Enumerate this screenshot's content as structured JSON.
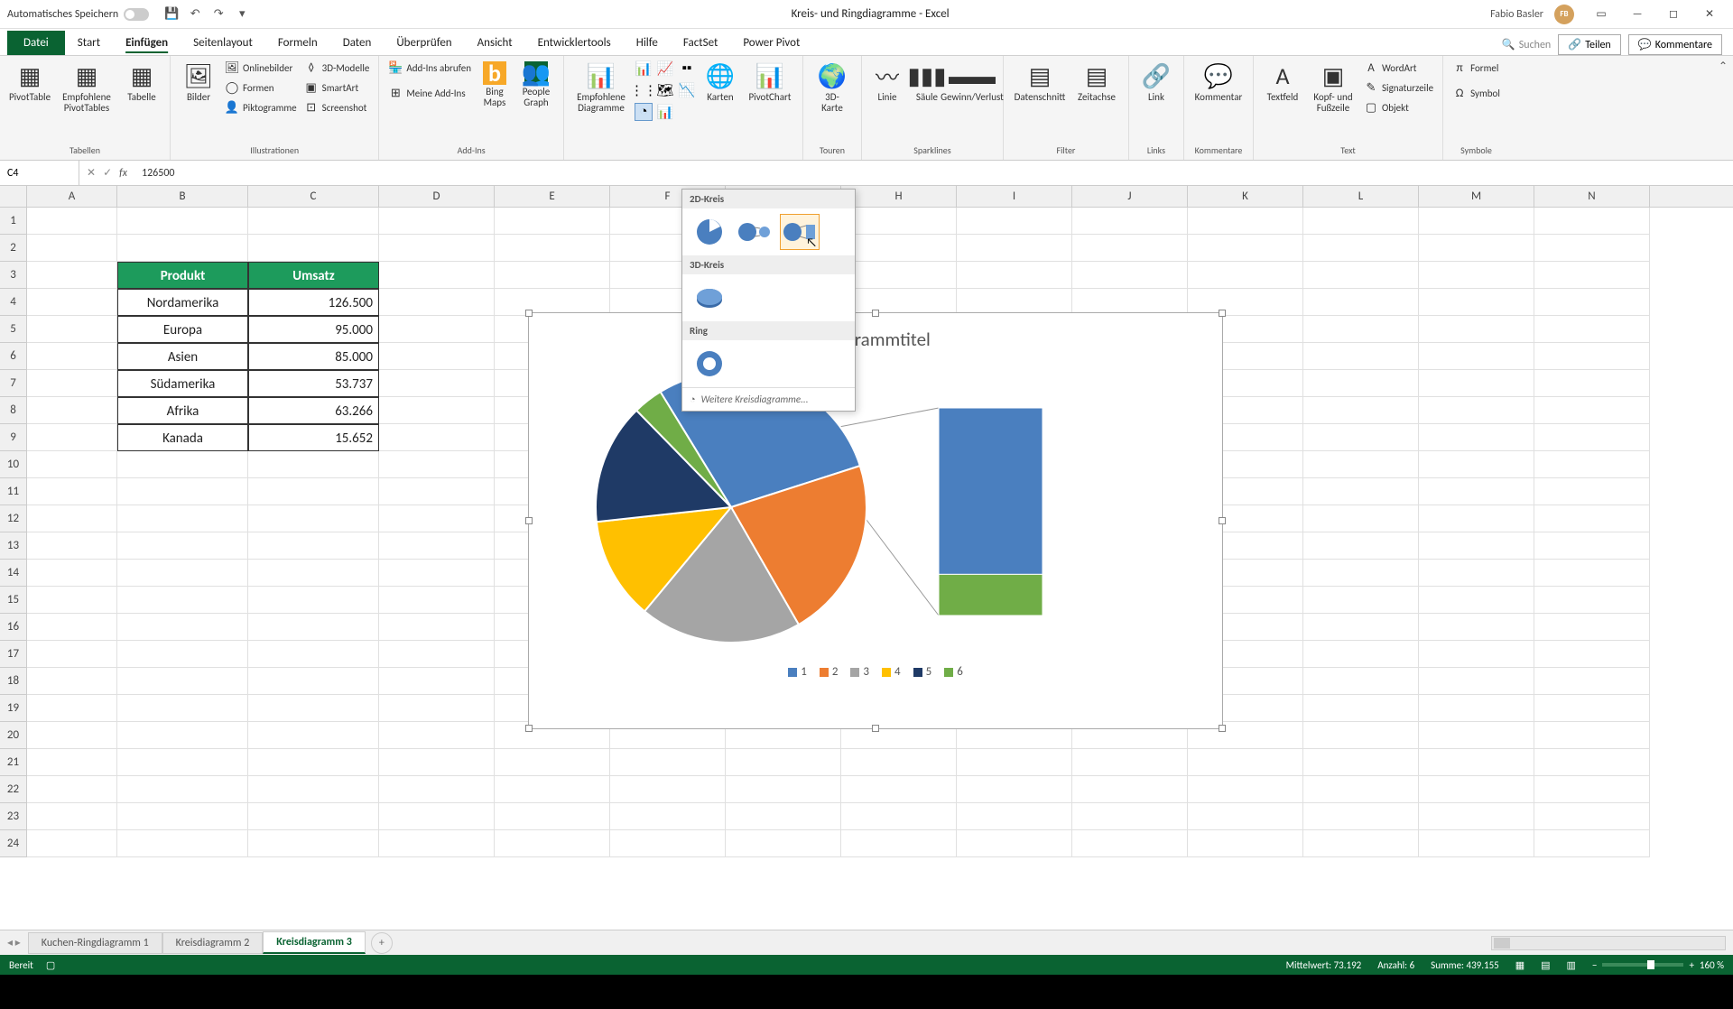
{
  "title_bar": {
    "autosave": "Automatisches Speichern",
    "title": "Kreis- und Ringdiagramme - Excel",
    "user": "Fabio Basler",
    "user_initials": "FB"
  },
  "tabs": {
    "file": "Datei",
    "items": [
      "Start",
      "Einfügen",
      "Seitenlayout",
      "Formeln",
      "Daten",
      "Überprüfen",
      "Ansicht",
      "Entwicklertools",
      "Hilfe",
      "FactSet",
      "Power Pivot"
    ],
    "active": "Einfügen",
    "search_placeholder": "Suchen",
    "share": "Teilen",
    "comments": "Kommentare"
  },
  "ribbon": {
    "groups": {
      "tables": {
        "label": "Tabellen",
        "pivot": "PivotTable",
        "recommended": "Empfohlene PivotTables",
        "table": "Tabelle"
      },
      "illustrations": {
        "label": "Illustrationen",
        "pictures": "Bilder",
        "online": "Onlinebilder",
        "shapes": "Formen",
        "piktogram": "Piktogramme",
        "models": "3D-Modelle",
        "smartart": "SmartArt",
        "screenshot": "Screenshot"
      },
      "addins": {
        "label": "Add-Ins",
        "get": "Add-Ins abrufen",
        "my": "Meine Add-Ins",
        "bing": "Bing Maps",
        "people": "People Graph"
      },
      "charts": {
        "label": "",
        "recommended": "Empfohlene Diagramme",
        "maps": "Karten",
        "pivotchart": "PivotChart"
      },
      "tours": {
        "label": "Touren",
        "map3d": "3D-Karte"
      },
      "sparklines": {
        "label": "Sparklines",
        "line": "Linie",
        "column": "Säule",
        "winloss": "Gewinn/Verlust"
      },
      "filter": {
        "label": "Filter",
        "slicer": "Datenschnitt",
        "timeline": "Zeitachse"
      },
      "links": {
        "label": "Links",
        "link": "Link"
      },
      "comments": {
        "label": "Kommentare",
        "comment": "Kommentar"
      },
      "text": {
        "label": "Text",
        "textbox": "Textfeld",
        "headerfooter": "Kopf- und Fußzeile",
        "wordart": "WordArt",
        "signature": "Signaturzeile",
        "object": "Objekt"
      },
      "symbols": {
        "label": "Symbole",
        "equation": "Formel",
        "symbol": "Symbol"
      }
    }
  },
  "dropdown": {
    "h1": "2D-Kreis",
    "h2": "3D-Kreis",
    "h3": "Ring",
    "more": "Weitere Kreisdiagramme..."
  },
  "formula": {
    "cell_ref": "C4",
    "value": "126500"
  },
  "columns": [
    "A",
    "B",
    "C",
    "D",
    "E",
    "F",
    "G",
    "H",
    "I",
    "J",
    "K",
    "L",
    "M",
    "N"
  ],
  "table": {
    "header": [
      "Produkt",
      "Umsatz"
    ],
    "rows": [
      [
        "Nordamerika",
        "126.500"
      ],
      [
        "Europa",
        "95.000"
      ],
      [
        "Asien",
        "85.000"
      ],
      [
        "Südamerika",
        "53.737"
      ],
      [
        "Afrika",
        "63.266"
      ],
      [
        "Kanada",
        "15.652"
      ]
    ]
  },
  "chart_data": {
    "type": "pie",
    "title": "Diagrammtitel",
    "categories": [
      "1",
      "2",
      "3",
      "4",
      "5",
      "6"
    ],
    "values": [
      126500,
      95000,
      85000,
      53737,
      63266,
      15652
    ],
    "colors": [
      "#4a7fbf",
      "#ed7d31",
      "#a5a5a5",
      "#ffc000",
      "#1f3a66",
      "#70ad47"
    ],
    "bar_subset": {
      "categories": [
        "5",
        "6"
      ],
      "values": [
        63266,
        15652
      ],
      "colors": [
        "#4a7fbf",
        "#70ad47"
      ]
    },
    "legend_position": "bottom"
  },
  "sheets": {
    "tabs": [
      "Kuchen-Ringdiagramm 1",
      "Kreisdiagramm 2",
      "Kreisdiagramm 3"
    ],
    "active": "Kreisdiagramm 3"
  },
  "status": {
    "ready": "Bereit",
    "avg_label": "Mittelwert:",
    "avg": "73.192",
    "count_label": "Anzahl:",
    "count": "6",
    "sum_label": "Summe:",
    "sum": "439.155",
    "zoom": "160 %"
  }
}
